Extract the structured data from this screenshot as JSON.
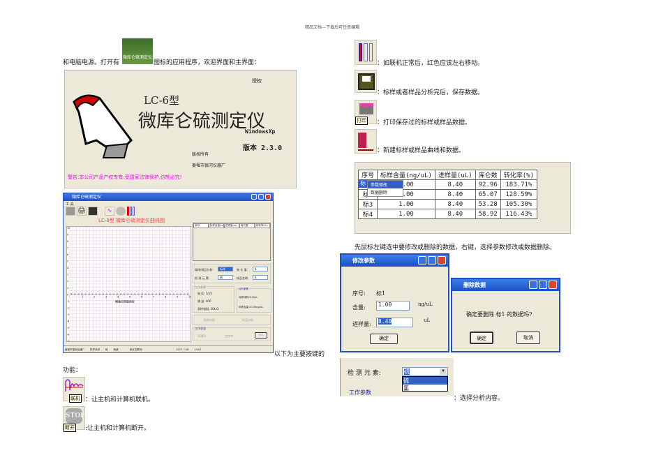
{
  "header": "精品文档---下载后可任意编辑",
  "intro": {
    "before": "和电脑电源。打开有",
    "icon_label": "微库仑硫测定仪",
    "after": "图标的应用程序，欢迎界面和主界面："
  },
  "splash": {
    "auth": "授权",
    "model": "LC-6型",
    "title": "微库仑硫测定仪",
    "os": "WindowsXp",
    "version": "版本 2.3.0",
    "copyright": "版权所有",
    "company": "姜堰市银河仪器厂",
    "warning": "警告:本公司产品产权专有,受国家法律保护,仿制必究!",
    "warning_color": "#ff00ff"
  },
  "main_window": {
    "menu": "工 具",
    "chart_title": "LC-6型 微库仑硫测定仪曲线图",
    "x_caption": "横轴目测量坐标",
    "y_ticks": [
      "10",
      "9",
      "8",
      "7",
      "6",
      "5",
      "4",
      "3",
      "2",
      "1",
      "0",
      "-1",
      "-2",
      "-3",
      "-4",
      "-5",
      "-6",
      "-7"
    ],
    "x_ticks": [
      "1",
      "2",
      "3",
      "4",
      "5",
      "6",
      "7",
      "8",
      "9",
      "10"
    ],
    "table_headers": [
      "序号",
      "标样含量(ng/uL)",
      "进样量(uL)",
      "库仑数",
      "转化率(%)"
    ],
    "fields": {
      "type_label": "标样/样品分析:",
      "type_value": "标样",
      "elec_label": "电 位 值:",
      "elec_value": "0",
      "elem_label": "检 测 元 素:",
      "elem_value": "硫",
      "name_label": "样品名称:",
      "name_value": "0"
    },
    "work_params": {
      "title": "工作参数",
      "p1": "电 压: 1mV",
      "p2": "增 益: 400",
      "p3": "采样电阻: 10k Ω"
    },
    "analysis_params": {
      "title": "分析参数",
      "a1": "标样体积:8.40uL",
      "a2": "标样含量:10.00ng/uL"
    },
    "radios": {
      "r1": "标样分析",
      "r2": "样品分析"
    },
    "work_state": {
      "title": "工作状态",
      "s1": "不通讯",
      "s2": "工作中",
      "btn": "启动"
    },
    "status": {
      "company": "姜堰市银河仪器厂",
      "mode": "标样分析",
      "elem": "硫",
      "state": "就绪",
      "hint": "请点击联机!",
      "date": "2013-7-26",
      "time": "13:07"
    }
  },
  "continued": "以下为主要按键的",
  "function_label": "功能：",
  "left_items": [
    {
      "icon_label": "联机",
      "desc": "：让主机和计算机联机。"
    },
    {
      "icon_label": "断开",
      "desc": ":让主机和计算机断开。"
    }
  ],
  "right_items": [
    {
      "desc": "：如联机正常后，红色应该左右移动。"
    },
    {
      "desc": "：标样或者样品分析完后，保存数据。"
    },
    {
      "icon_label": "打印",
      "desc": "：打印保存过的标样或样品数据。"
    },
    {
      "desc": "：新建标样或样品曲线和数据。"
    }
  ],
  "table": {
    "headers": [
      "序号",
      "标样含量(ng/uL)",
      "进样量(uL)",
      "库仑数",
      "转化率(%)"
    ],
    "rows": [
      [
        "标1",
        "1.00",
        "8.40",
        "92.96",
        "183.71%"
      ],
      [
        "标2",
        "1.00",
        "8.40",
        "65.07",
        "128.59%"
      ],
      [
        "标3",
        "1.00",
        "8.40",
        "53.28",
        "105.30%"
      ],
      [
        "标4",
        "1.00",
        "8.40",
        "58.92",
        "116.43%"
      ]
    ],
    "context_menu": [
      "参数修改",
      "数据删除"
    ]
  },
  "instruction": "先鼠标左键选中要修改或删除的数据，右键，选择参数修改或数据删除。",
  "edit_dialog": {
    "title": "修改参数",
    "seq_label": "序号:",
    "seq_value": "标1",
    "content_label": "含量:",
    "content_value": "1.00",
    "content_unit": "ng/uL",
    "volume_label": "进样量:",
    "volume_value": "8.40",
    "volume_unit": "uL",
    "ok": "确定"
  },
  "delete_dialog": {
    "title": "删除数据",
    "message": "确定要删除  标1  的数据吗?",
    "ok": "确定",
    "cancel": "取消"
  },
  "element_select": {
    "label": "检 测 元 素:",
    "value": "硫",
    "options": [
      "硫",
      "氯"
    ],
    "group": "工作参数",
    "desc": "：选择分析内容。"
  }
}
